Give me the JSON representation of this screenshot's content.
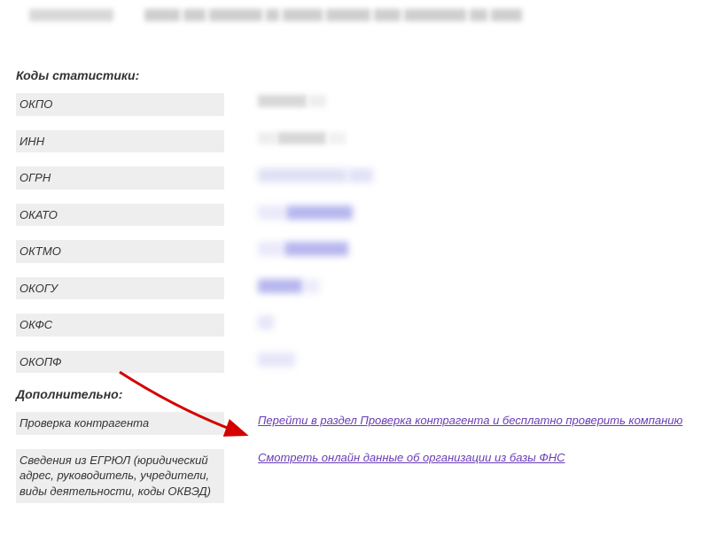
{
  "sections": {
    "stats_title": "Коды статистики:",
    "extra_title": "Дополнительно:"
  },
  "stats_rows": [
    {
      "label": "ОКПО"
    },
    {
      "label": "ИНН"
    },
    {
      "label": "ОГРН"
    },
    {
      "label": "ОКАТО"
    },
    {
      "label": "ОКТМО"
    },
    {
      "label": "ОКОГУ"
    },
    {
      "label": "ОКФС"
    },
    {
      "label": "ОКОПФ"
    }
  ],
  "extra_rows": {
    "check": {
      "label": "Проверка контрагента",
      "link": "Перейти в раздел Проверка контрагента и бесплатно проверить компанию"
    },
    "egrul": {
      "label": "Сведения из ЕГРЮЛ (юридический адрес, руководитель, учредители, виды деятельности, коды ОКВЭД)",
      "link": "Смотреть онлайн данные об организации из базы ФНС"
    }
  }
}
